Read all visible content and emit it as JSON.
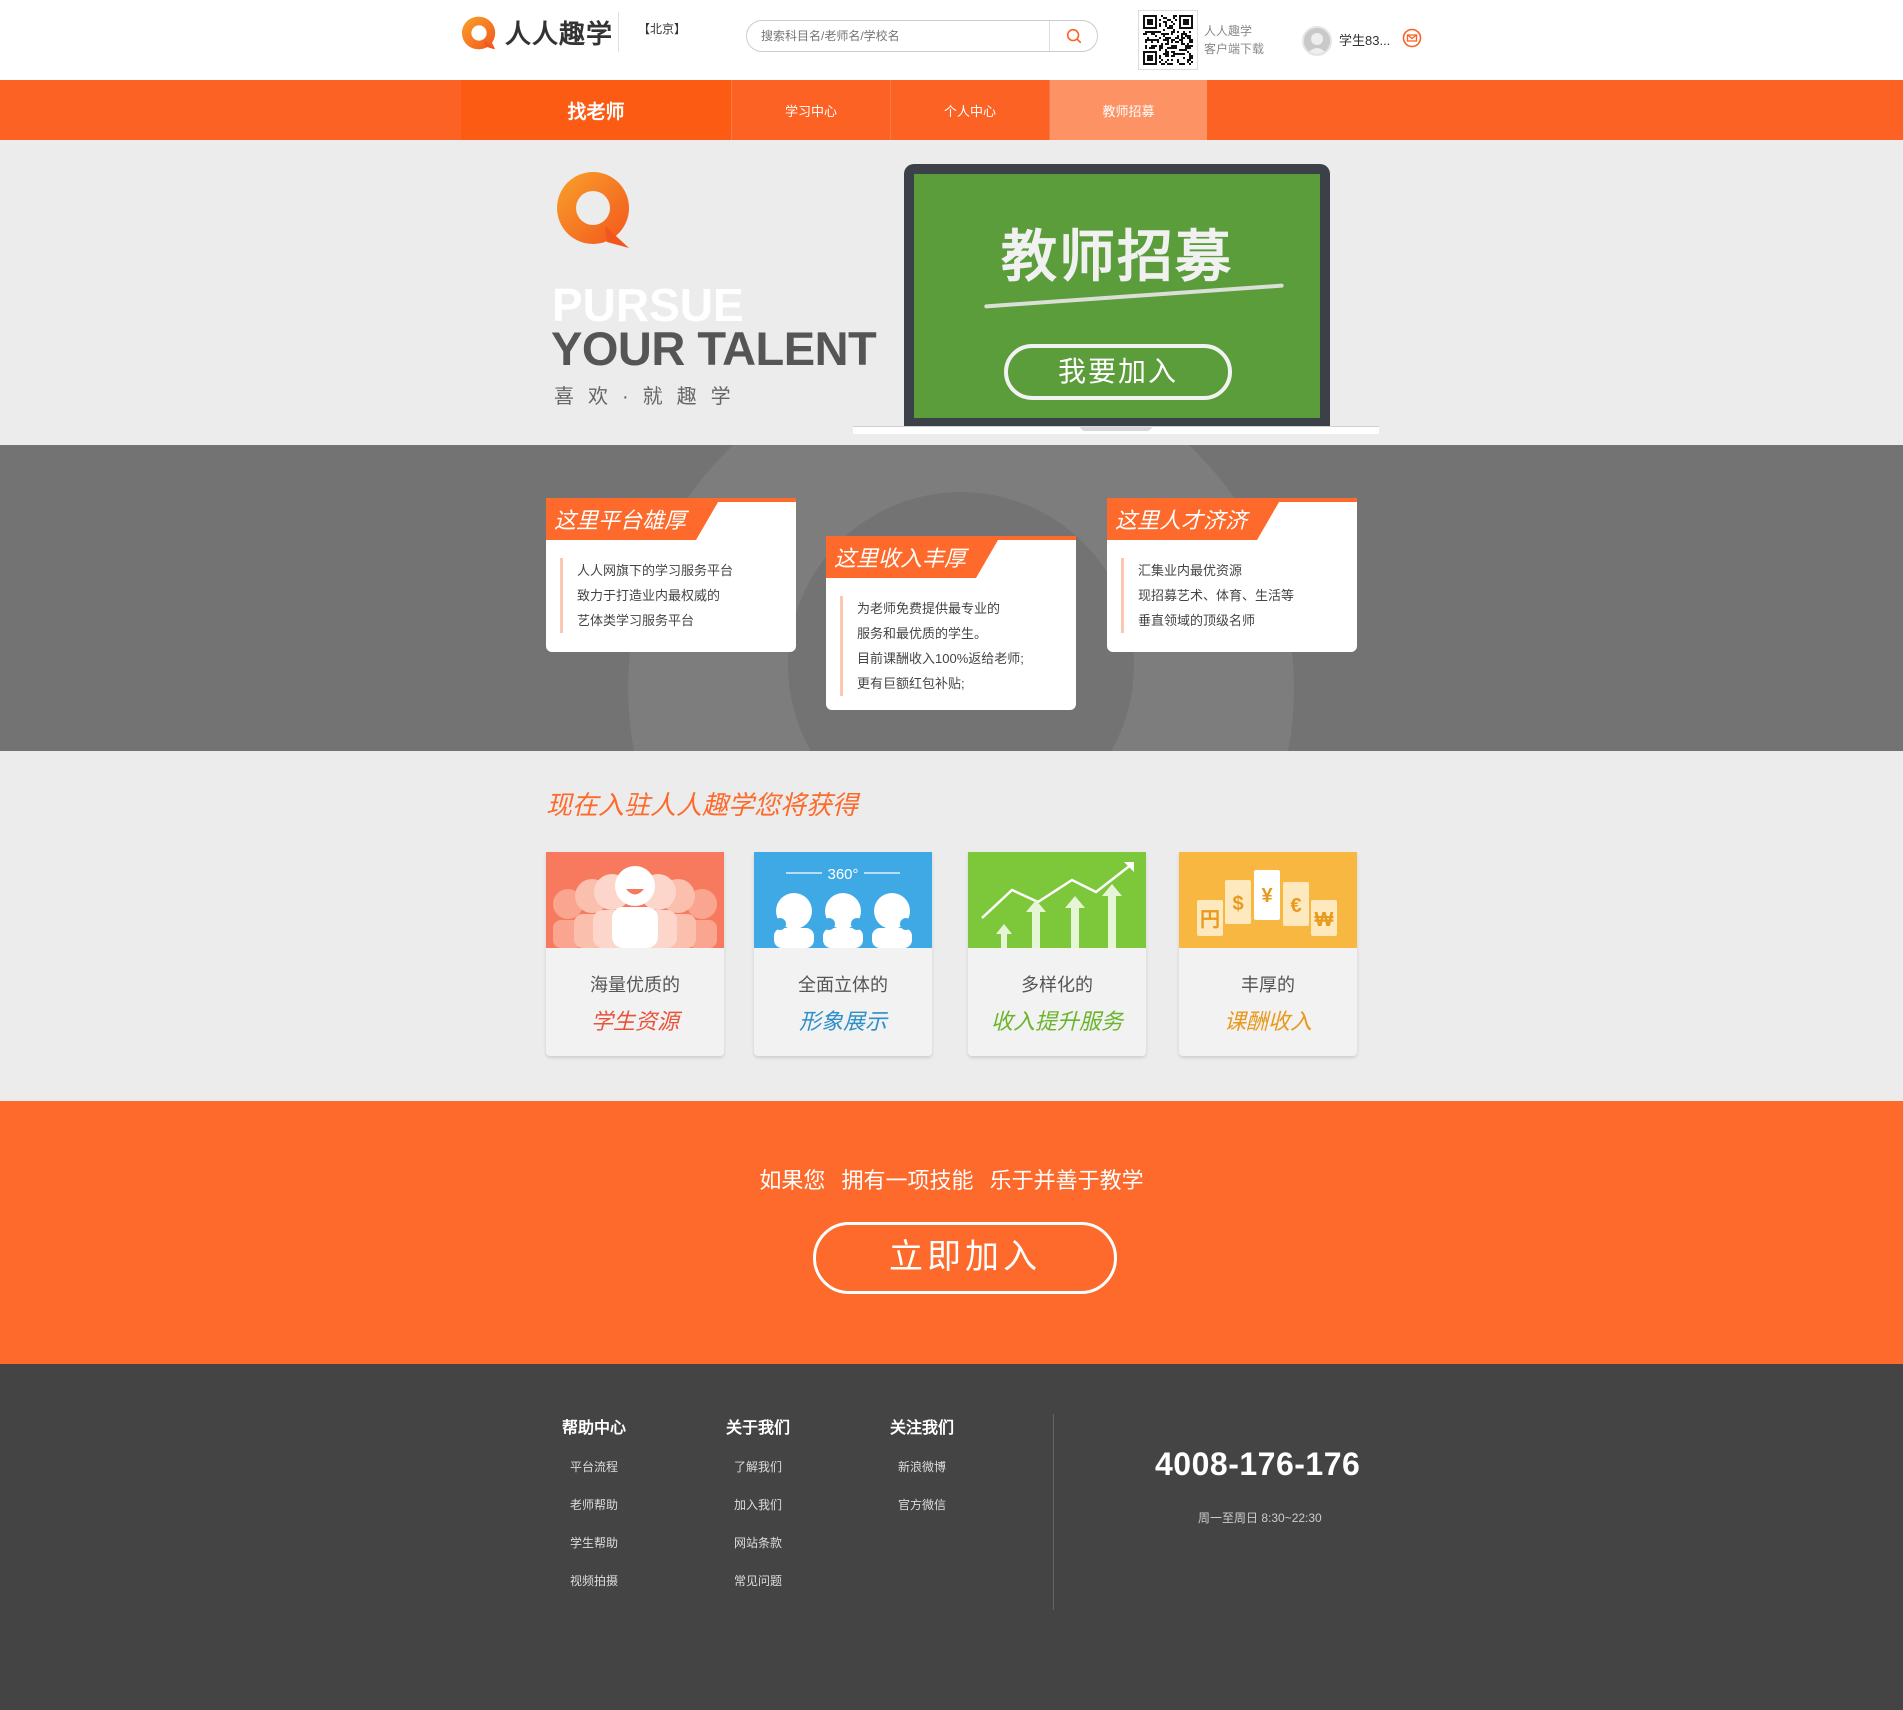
{
  "header": {
    "logo_text": "人人趣学",
    "city": "【北京】",
    "search_placeholder": "搜索科目名/老师名/学校名",
    "qr_line1": "人人趣学",
    "qr_line2": "客户端下载",
    "username": "学生83..."
  },
  "nav": {
    "items": [
      {
        "label": "找老师"
      },
      {
        "label": "学习中心"
      },
      {
        "label": "个人中心"
      },
      {
        "label": "教师招募"
      }
    ]
  },
  "hero": {
    "line1": "PURSUE",
    "line2": "YOUR TALENT",
    "slogan": "喜欢·就趣学",
    "board_title": "教师招募",
    "join_label": "我要加入"
  },
  "advantages": [
    {
      "tag": "这里平台雄厚",
      "lines": [
        "人人网旗下的学习服务平台",
        "致力于打造业内最权威的",
        "艺体类学习服务平台"
      ]
    },
    {
      "tag": "这里收入丰厚",
      "lines": [
        "为老师免费提供最专业的",
        "服务和最优质的学生。",
        "目前课酬收入100%返给老师;",
        "更有巨额红包补贴;"
      ]
    },
    {
      "tag": "这里人才济济",
      "lines": [
        "汇集业内最优资源",
        "现招募艺术、体育、生活等",
        "垂直领域的顶级名师"
      ]
    }
  ],
  "benefits": {
    "title": "现在入驻人人趣学您将获得",
    "cards": [
      {
        "sub": "海量优质的",
        "main": "学生资源",
        "color": "#f77a5e",
        "main_color": "#e8543a"
      },
      {
        "sub": "全面立体的",
        "main": "形象展示",
        "color": "#3fa9e6",
        "main_color": "#2e8fc9",
        "badge": "360°"
      },
      {
        "sub": "多样化的",
        "main": "收入提升服务",
        "color": "#7cc83a",
        "main_color": "#6ab52c"
      },
      {
        "sub": "丰厚的",
        "main": "课酬收入",
        "color": "#f7b740",
        "main_color": "#e89a1c",
        "currencies": [
          "円",
          "$",
          "¥",
          "€",
          "₩"
        ]
      }
    ]
  },
  "cta": {
    "text": "如果您  拥有一项技能  乐于并善于教学",
    "button": "立即加入"
  },
  "footer": {
    "columns": [
      {
        "title": "帮助中心",
        "links": [
          "平台流程",
          "老师帮助",
          "学生帮助",
          "视频拍摄"
        ]
      },
      {
        "title": "关于我们",
        "links": [
          "了解我们",
          "加入我们",
          "网站条款",
          "常见问题"
        ]
      },
      {
        "title": "关注我们",
        "links": [
          "新浪微博",
          "官方微信"
        ]
      }
    ],
    "phone": "4008-176-176",
    "hours": "周一至周日 8:30~22:30"
  },
  "colors": {
    "brand_orange": "#fd6225",
    "footer_bg": "#444444"
  }
}
